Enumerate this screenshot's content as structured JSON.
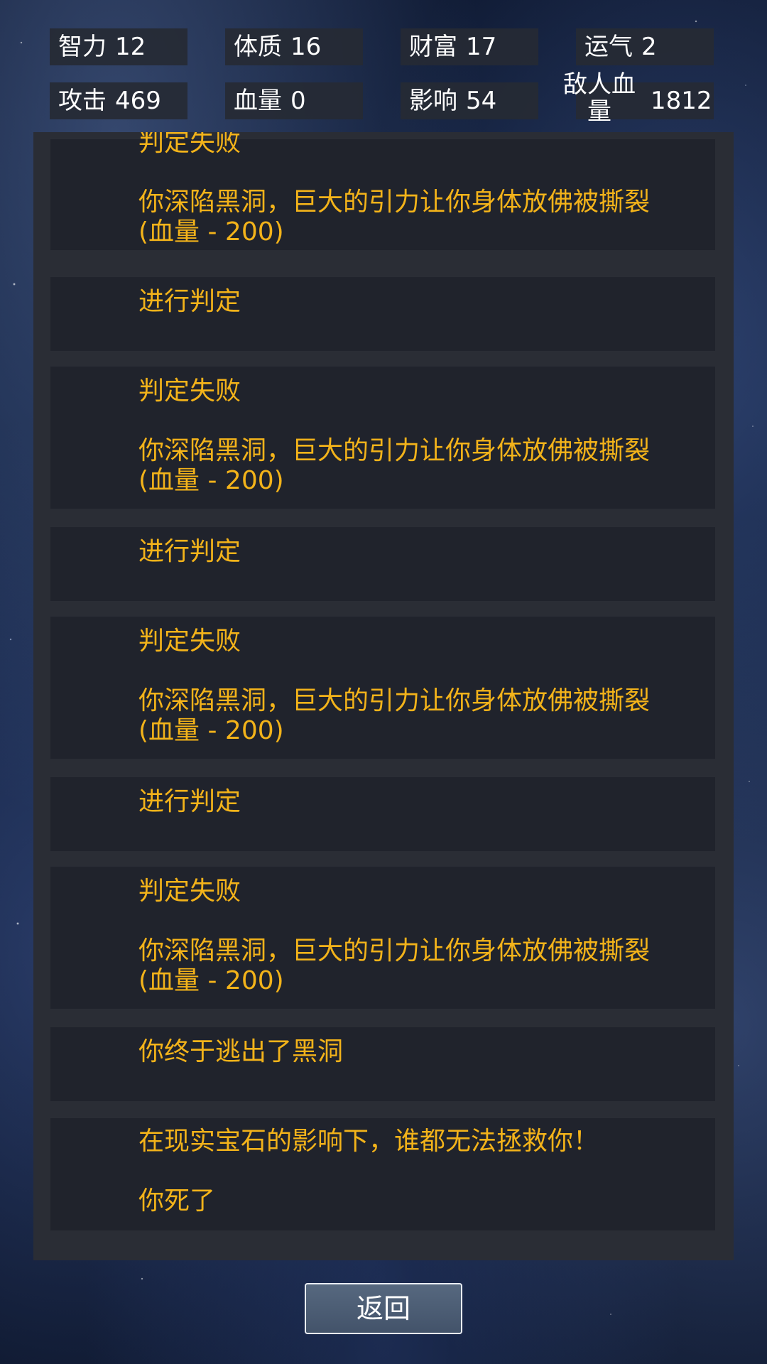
{
  "stats": {
    "intelligence": {
      "label": "智力",
      "value": "12"
    },
    "constitution": {
      "label": "体质",
      "value": "16"
    },
    "wealth": {
      "label": "财富",
      "value": "17"
    },
    "luck": {
      "label": "运气",
      "value": "2"
    },
    "attack": {
      "label": "攻击",
      "value": "469"
    },
    "hp": {
      "label": "血量",
      "value": "0"
    },
    "influence": {
      "label": "影响",
      "value": "54"
    },
    "enemy_hp": {
      "label_line1": "敌人血",
      "label_line2": "量",
      "value": "1812"
    }
  },
  "log": [
    {
      "text": "判定失败"
    },
    {
      "text": "你深陷黑洞，巨大的引力让你身体放佛被撕裂(血量 - 200)"
    },
    {
      "text": "进行判定"
    },
    {
      "text": "判定失败\n\n你深陷黑洞，巨大的引力让你身体放佛被撕裂(血量 - 200)"
    },
    {
      "text": "进行判定"
    },
    {
      "text": "判定失败\n\n你深陷黑洞，巨大的引力让你身体放佛被撕裂(血量 - 200)"
    },
    {
      "text": "进行判定"
    },
    {
      "text": "判定失败\n\n你深陷黑洞，巨大的引力让你身体放佛被撕裂(血量 - 200)"
    },
    {
      "text": "你终于逃出了黑洞"
    },
    {
      "text": "在现实宝石的影响下，谁都无法拯救你！\n\n你死了"
    }
  ],
  "back_button": {
    "label": "返回"
  }
}
